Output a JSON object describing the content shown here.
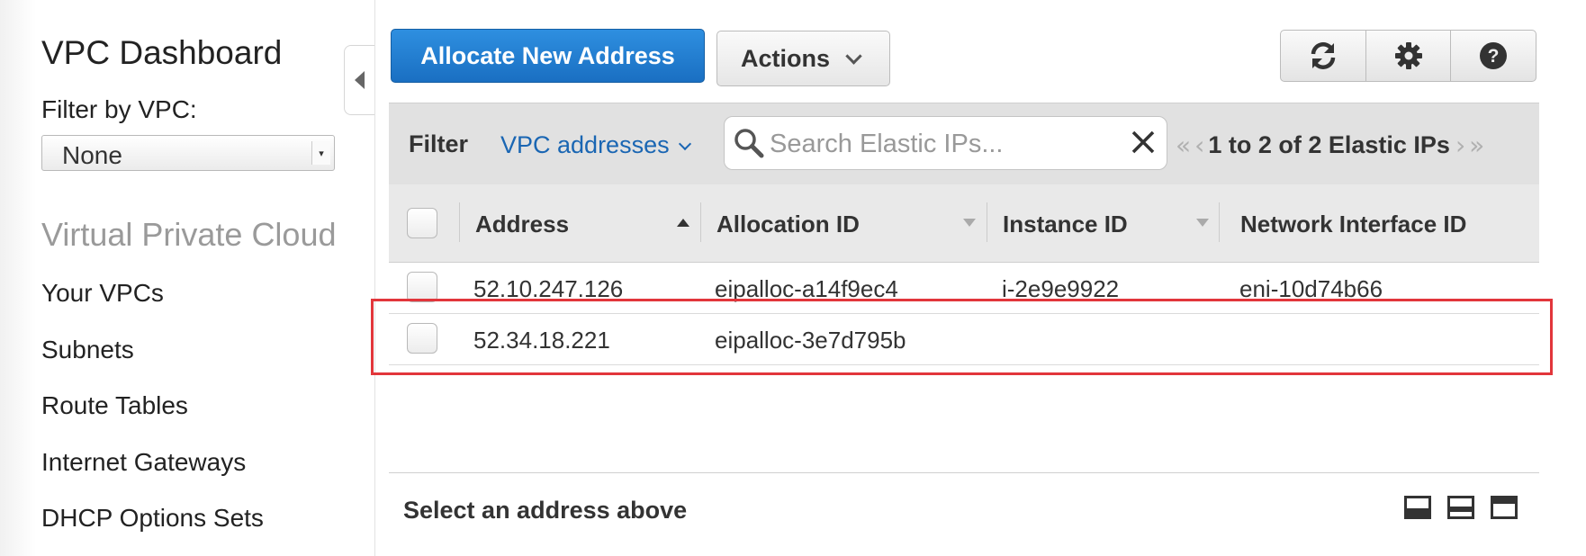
{
  "sidebar": {
    "title": "VPC Dashboard",
    "filter_label": "Filter by VPC:",
    "filter_value": "None",
    "section_title": "Virtual Private Cloud",
    "items": [
      {
        "label": "Your VPCs"
      },
      {
        "label": "Subnets"
      },
      {
        "label": "Route Tables"
      },
      {
        "label": "Internet Gateways"
      },
      {
        "label": "DHCP Options Sets"
      }
    ]
  },
  "toolbar": {
    "allocate_label": "Allocate New Address",
    "actions_label": "Actions",
    "icons": [
      "refresh-icon",
      "gear-icon",
      "help-icon"
    ]
  },
  "filter": {
    "label": "Filter",
    "dropdown_value": "VPC addresses",
    "search_placeholder": "Search Elastic IPs...",
    "pagination_text": "1 to 2 of 2 Elastic IPs"
  },
  "table": {
    "columns": [
      "Address",
      "Allocation ID",
      "Instance ID",
      "Network Interface ID"
    ],
    "rows": [
      {
        "address": "52.10.247.126",
        "allocation_id": "eipalloc-a14f9ec4",
        "instance_id": "i-2e9e9922",
        "eni_id": "eni-10d74b66"
      },
      {
        "address": "52.34.18.221",
        "allocation_id": "eipalloc-3e7d795b",
        "instance_id": "",
        "eni_id": ""
      }
    ]
  },
  "details": {
    "placeholder": "Select an address above"
  },
  "colors": {
    "primary_button": "#1a6fc2",
    "link_blue": "#1a66b3",
    "highlight_border": "#e2363b"
  }
}
